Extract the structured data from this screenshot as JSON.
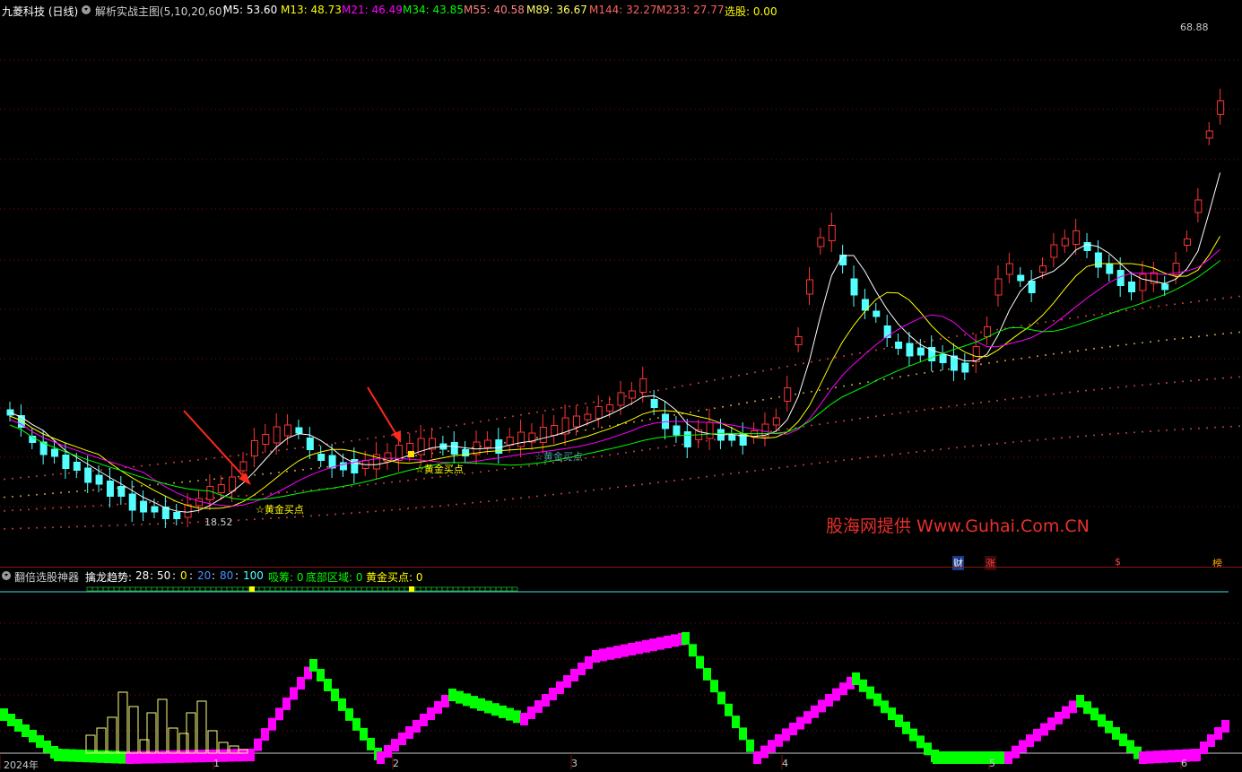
{
  "main_header": {
    "stock_name": "九菱科技 (日线)",
    "indicator_name": "解析实战主图(5,10,20,60)",
    "items": [
      {
        "label": "M5: 53.60",
        "color": "#ffffff"
      },
      {
        "label": "M13: 48.73",
        "color": "#ffff00"
      },
      {
        "label": "M21: 46.49",
        "color": "#ff00ff"
      },
      {
        "label": "M34: 43.85",
        "color": "#00ff00"
      },
      {
        "label": "M55: 40.58",
        "color": "#ff8080"
      },
      {
        "label": "M89: 36.67",
        "color": "#ffff66"
      },
      {
        "label": "M144: 32.27",
        "color": "#ff6060"
      },
      {
        "label": "M233: 27.77",
        "color": "#ff6060"
      },
      {
        "label": "选股: 0.00",
        "color": "#ffff00"
      }
    ]
  },
  "sub_header": {
    "indicator_name": "翻倍选股神器",
    "trend_label": "擒龙趋势:",
    "levels": [
      "28",
      "50",
      "0",
      "20",
      "80",
      "100"
    ],
    "xichou": "吸筹: 0",
    "dibu": "底部区域: 0",
    "huangjin": "黄金买点: 0"
  },
  "annotations": {
    "high_label": "68.88",
    "low_label": "18.52",
    "buy_label_1": "☆黄金买点",
    "buy_label_2": "☆黄金买点",
    "buy_label_3": "☆黄金买点"
  },
  "markers": {
    "cai": "财",
    "zhang": "涨",
    "dollar": "$",
    "bang": "榜"
  },
  "watermark": "股海网提供 Www.Guhai.Com.CN",
  "x_axis": [
    "2024年",
    "1",
    "2",
    "3",
    "4",
    "5",
    "6"
  ],
  "chart_data": {
    "type": "candlestick",
    "period": "daily",
    "price_high": 68.88,
    "price_low": 18.52,
    "moving_averages": {
      "M5": 53.6,
      "M13": 48.73,
      "M21": 46.49,
      "M34": 43.85,
      "M55": 40.58,
      "M89": 36.67,
      "M144": 32.27,
      "M233": 27.77
    },
    "colors": {
      "up": "#ff3333",
      "down": "#54ffff",
      "M5": "#ffffff",
      "M13": "#ffff00",
      "M21": "#ff00ff",
      "M34": "#00ff00"
    },
    "sub_chart": {
      "type": "step",
      "colors": {
        "rising": "#ff00ff",
        "falling": "#00ff00",
        "volume_bars": "#ffff80"
      }
    }
  }
}
